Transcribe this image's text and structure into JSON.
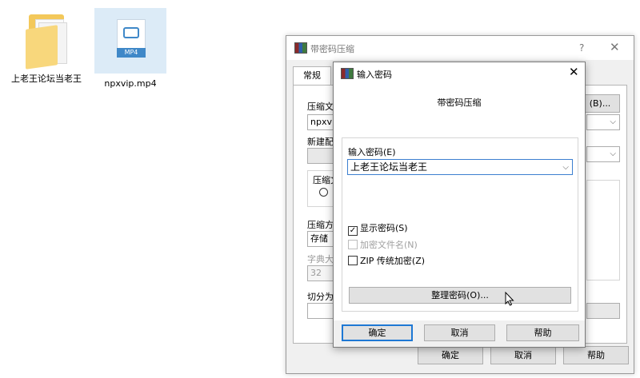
{
  "desktop": {
    "folder_label": "上老王论坛当老王",
    "video_label": "npxvip.mp4",
    "video_badge": "MP4"
  },
  "main_dialog": {
    "title": "带密码压缩",
    "help_glyph": "?",
    "close_glyph": "✕",
    "tab": "常规",
    "labels": {
      "archive_name": "压缩文",
      "archive_value": "npxvip",
      "browse": "(B)...",
      "new_profile": "新建配",
      "format_group": "压缩文",
      "method": "压缩方",
      "method_value": "存储",
      "dict_size": "字典大",
      "dict_value": "32",
      "split": "切分为"
    },
    "buttons": {
      "ok": "确定",
      "cancel": "取消",
      "help": "帮助"
    }
  },
  "password_dialog": {
    "title": "输入密码",
    "close_glyph": "✕",
    "heading": "带密码压缩",
    "input_label": "输入密码(E)",
    "password_value": "上老王论坛当老王",
    "checkboxes": {
      "show_password": "显示密码(S)",
      "encrypt_filenames": "加密文件名(N)",
      "zip_legacy": "ZIP 传统加密(Z)"
    },
    "organize_button": "整理密码(O)...",
    "buttons": {
      "ok": "确定",
      "cancel": "取消",
      "help": "帮助"
    }
  }
}
